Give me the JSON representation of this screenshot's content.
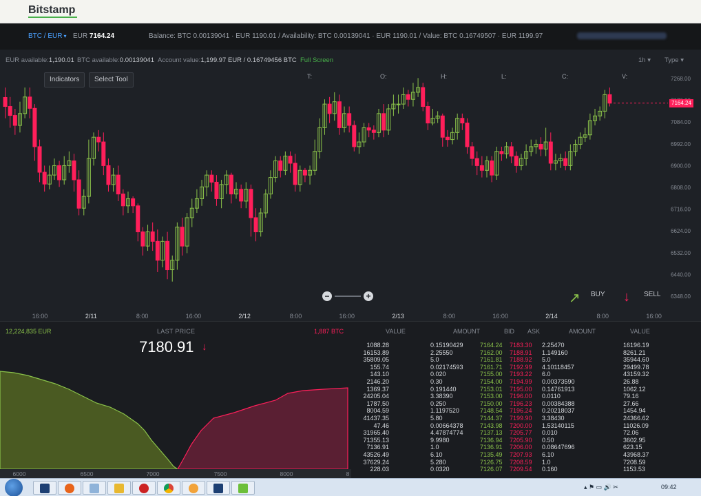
{
  "app": {
    "logo": "Bitstamp"
  },
  "account": {
    "pair": "BTC / EUR",
    "pair_caret": "▾",
    "eur_label": "EUR",
    "eur_price": "7164.24",
    "balance_line": "Balance: BTC 0.00139041 · EUR 1190.01 / Availability: BTC 0.00139041 · EUR 1190.01 / Value: BTC 0.16749507 · EUR 1199.97"
  },
  "info": {
    "eur_available_label": "EUR available:",
    "eur_available": "1,190.01",
    "btc_available_label": "BTC available:",
    "btc_available": "0.00139041",
    "account_value_label": "Account value:",
    "account_value": "1,199.97 EUR / 0.16749456 BTC",
    "fullscreen": "Full Screen",
    "timeframe": "1h",
    "type": "Type"
  },
  "chart_toolbar": {
    "indicators": "Indicators",
    "select_tool": "Select Tool",
    "ohlcv": [
      "T:",
      "O:",
      "H:",
      "L:",
      "C:",
      "V:"
    ]
  },
  "chart_data": {
    "type": "candlestick",
    "current_price": "7164.24",
    "y_ticks": [
      "7268.00",
      "7176.00",
      "7084.00",
      "6992.00",
      "6900.00",
      "6808.00",
      "6716.00",
      "6624.00",
      "6532.00",
      "6440.00",
      "6348.00"
    ],
    "x_ticks": [
      "16:00",
      "2/11",
      "8:00",
      "16:00",
      "2/12",
      "8:00",
      "16:00",
      "2/13",
      "8:00",
      "16:00",
      "2/14",
      "8:00",
      "16:00"
    ],
    "ylim": [
      6348,
      7268
    ],
    "candles": [
      [
        7188,
        7150,
        7100,
        7230
      ],
      [
        7150,
        7112,
        7060,
        7190
      ],
      [
        7112,
        7070,
        7030,
        7140
      ],
      [
        7070,
        7120,
        7040,
        7170
      ],
      [
        7120,
        7190,
        7100,
        7230
      ],
      [
        7190,
        7142,
        7100,
        7230
      ],
      [
        7142,
        6980,
        6920,
        7160
      ],
      [
        6980,
        6872,
        6830,
        7010
      ],
      [
        6872,
        6822,
        6790,
        6900
      ],
      [
        6822,
        6860,
        6800,
        6900
      ],
      [
        6860,
        6900,
        6840,
        6930
      ],
      [
        6900,
        6840,
        6810,
        6920
      ],
      [
        6840,
        6900,
        6820,
        6940
      ],
      [
        6900,
        6920,
        6870,
        6960
      ],
      [
        6920,
        6840,
        6790,
        6950
      ],
      [
        6840,
        6720,
        6690,
        6880
      ],
      [
        6720,
        6770,
        6690,
        6800
      ],
      [
        6770,
        6930,
        6740,
        7010
      ],
      [
        6930,
        7020,
        6900,
        7040
      ],
      [
        7020,
        7000,
        6960,
        7050
      ],
      [
        7000,
        6900,
        6860,
        7040
      ],
      [
        6900,
        6820,
        6790,
        6930
      ],
      [
        6820,
        6860,
        6790,
        6890
      ],
      [
        6860,
        6780,
        6750,
        6900
      ],
      [
        6780,
        6730,
        6690,
        6800
      ],
      [
        6730,
        6760,
        6700,
        6790
      ],
      [
        6760,
        6730,
        6700,
        6770
      ],
      [
        6730,
        6620,
        6580,
        6740
      ],
      [
        6620,
        6560,
        6520,
        6640
      ],
      [
        6560,
        6620,
        6540,
        6650
      ],
      [
        6620,
        6580,
        6540,
        6660
      ],
      [
        6580,
        6500,
        6450,
        6630
      ],
      [
        6500,
        6580,
        6470,
        6600
      ],
      [
        6580,
        6460,
        6420,
        6620
      ],
      [
        6460,
        6500,
        6410,
        6520
      ],
      [
        6500,
        6640,
        6460,
        6660
      ],
      [
        6640,
        6560,
        6520,
        6680
      ],
      [
        6560,
        6680,
        6530,
        6700
      ],
      [
        6680,
        6720,
        6640,
        6760
      ],
      [
        6720,
        6760,
        6700,
        6800
      ],
      [
        6760,
        6810,
        6730,
        6840
      ],
      [
        6810,
        6860,
        6770,
        6880
      ],
      [
        6860,
        6830,
        6790,
        6880
      ],
      [
        6830,
        6760,
        6730,
        6860
      ],
      [
        6760,
        6820,
        6720,
        6840
      ],
      [
        6820,
        6860,
        6780,
        6880
      ],
      [
        6860,
        6780,
        6740,
        6870
      ],
      [
        6780,
        6800,
        6760,
        6830
      ],
      [
        6800,
        6750,
        6720,
        6820
      ],
      [
        6750,
        6800,
        6720,
        6830
      ],
      [
        6800,
        6680,
        6600,
        6820
      ],
      [
        6680,
        6620,
        6580,
        6720
      ],
      [
        6620,
        6700,
        6600,
        6720
      ],
      [
        6700,
        6780,
        6680,
        6800
      ],
      [
        6780,
        6850,
        6760,
        6880
      ],
      [
        6850,
        6920,
        6830,
        6940
      ],
      [
        6920,
        6880,
        6850,
        6940
      ],
      [
        6880,
        6940,
        6860,
        6960
      ],
      [
        6940,
        6910,
        6870,
        6960
      ],
      [
        6910,
        6820,
        6790,
        6950
      ],
      [
        6820,
        6880,
        6790,
        6900
      ],
      [
        6880,
        6860,
        6830,
        6890
      ],
      [
        6860,
        6880,
        6820,
        6900
      ],
      [
        6880,
        6960,
        6860,
        7010
      ],
      [
        6960,
        7060,
        6930,
        7100
      ],
      [
        7060,
        7160,
        7030,
        7180
      ],
      [
        7160,
        7120,
        7080,
        7190
      ],
      [
        7120,
        7170,
        7090,
        7210
      ],
      [
        7170,
        7060,
        7030,
        7200
      ],
      [
        7060,
        7120,
        7040,
        7150
      ],
      [
        7120,
        7070,
        7040,
        7150
      ],
      [
        7070,
        6980,
        6960,
        7090
      ],
      [
        6980,
        7000,
        6950,
        7040
      ],
      [
        7000,
        7060,
        6980,
        7080
      ],
      [
        7060,
        7050,
        7020,
        7080
      ],
      [
        7050,
        7040,
        7010,
        7070
      ],
      [
        7040,
        7120,
        7020,
        7140
      ],
      [
        7120,
        7050,
        7020,
        7160
      ],
      [
        7050,
        7140,
        7030,
        7160
      ],
      [
        7140,
        7160,
        7110,
        7200
      ],
      [
        7160,
        7160,
        7120,
        7200
      ],
      [
        7160,
        7200,
        7140,
        7230
      ],
      [
        7200,
        7180,
        7150,
        7220
      ],
      [
        7180,
        7210,
        7150,
        7250
      ],
      [
        7210,
        7230,
        7190,
        7270
      ],
      [
        7230,
        7150,
        7130,
        7250
      ],
      [
        7150,
        7080,
        7050,
        7170
      ],
      [
        7080,
        7100,
        7070,
        7140
      ],
      [
        7100,
        7110,
        7080,
        7130
      ],
      [
        7110,
        7020,
        6980,
        7120
      ],
      [
        7020,
        7010,
        6980,
        7050
      ],
      [
        7010,
        7040,
        6990,
        7060
      ],
      [
        7040,
        7100,
        7010,
        7120
      ],
      [
        7100,
        7080,
        7050,
        7120
      ],
      [
        7080,
        6980,
        6950,
        7100
      ],
      [
        6980,
        6930,
        6900,
        7000
      ],
      [
        6930,
        6900,
        6860,
        6960
      ],
      [
        6900,
        6880,
        6850,
        6940
      ],
      [
        6880,
        6920,
        6850,
        6940
      ],
      [
        6920,
        6860,
        6830,
        6940
      ],
      [
        6860,
        6960,
        6840,
        6980
      ],
      [
        6960,
        6950,
        6920,
        6980
      ],
      [
        6950,
        6980,
        6930,
        7000
      ],
      [
        6980,
        6940,
        6910,
        7000
      ],
      [
        6940,
        6900,
        6870,
        6960
      ],
      [
        6900,
        6930,
        6880,
        6950
      ],
      [
        6930,
        6960,
        6900,
        6990
      ],
      [
        6960,
        6980,
        6940,
        7010
      ],
      [
        6980,
        6990,
        6950,
        7010
      ],
      [
        6990,
        6970,
        6940,
        7020
      ],
      [
        6970,
        7000,
        6940,
        7060
      ],
      [
        7000,
        6910,
        6880,
        7040
      ],
      [
        6910,
        6920,
        6880,
        6950
      ],
      [
        6920,
        6930,
        6890,
        6950
      ],
      [
        6930,
        6900,
        6880,
        6960
      ],
      [
        6900,
        6960,
        6880,
        6990
      ],
      [
        6960,
        6990,
        6940,
        7010
      ],
      [
        6990,
        7020,
        6970,
        7040
      ],
      [
        7020,
        7030,
        7000,
        7060
      ],
      [
        7030,
        7090,
        7010,
        7120
      ],
      [
        7090,
        7110,
        7070,
        7140
      ],
      [
        7110,
        7130,
        7090,
        7150
      ],
      [
        7130,
        7200,
        7100,
        7220
      ],
      [
        7200,
        7164,
        7150,
        7230
      ]
    ]
  },
  "trade": {
    "buy": "BUY",
    "sell": "SELL",
    "buy_arrow": "↗",
    "sell_arrow": "↓"
  },
  "depth_data": {
    "buy_total": "12,224,835 EUR",
    "sell_total": "1,887 BTC",
    "last_price_label": "LAST PRICE",
    "last_price": "7180.91",
    "last_price_arrow": "↓",
    "x_ticks": [
      "6000",
      "6500",
      "7000",
      "7500",
      "8000",
      "8"
    ],
    "buy_color": "#8bc34a",
    "sell_color": "#ff1f5a"
  },
  "order_book": {
    "headers": {
      "value": "VALUE",
      "amount": "AMOUNT",
      "bid": "BID",
      "ask": "ASK",
      "amount2": "AMOUNT",
      "value2": "VALUE"
    },
    "rows": [
      [
        "1088.28",
        "0.15190429",
        "7164.24",
        "7183.30",
        "2.25470",
        "16196.19"
      ],
      [
        "16153.89",
        "2.25550",
        "7162.00",
        "7188.91",
        "1.149160",
        "8261.21"
      ],
      [
        "35809.05",
        "5.0",
        "7161.81",
        "7188.92",
        "5.0",
        "35944.60"
      ],
      [
        "155.74",
        "0.02174593",
        "7161.71",
        "7192.99",
        "4.10118457",
        "29499.78"
      ],
      [
        "143.10",
        "0.020",
        "7155.00",
        "7193.22",
        "6.0",
        "43159.32"
      ],
      [
        "2146.20",
        "0.30",
        "7154.00",
        "7194.99",
        "0.00373590",
        "26.88"
      ],
      [
        "1369.37",
        "0.191440",
        "7153.01",
        "7195.00",
        "0.14761913",
        "1062.12"
      ],
      [
        "24205.04",
        "3.38390",
        "7153.00",
        "7196.00",
        "0.0110",
        "79.16"
      ],
      [
        "1787.50",
        "0.250",
        "7150.00",
        "7196.23",
        "0.00384388",
        "27.66"
      ],
      [
        "8004.59",
        "1.1197520",
        "7148.54",
        "7196.24",
        "0.20218037",
        "1454.94"
      ],
      [
        "41437.35",
        "5.80",
        "7144.37",
        "7199.90",
        "3.38430",
        "24366.62"
      ],
      [
        "47.46",
        "0.00664378",
        "7143.98",
        "7200.00",
        "1.53140115",
        "11026.09"
      ],
      [
        "31965.40",
        "4.47874774",
        "7137.13",
        "7205.77",
        "0.010",
        "72.06"
      ],
      [
        "71355.13",
        "9.9980",
        "7136.94",
        "7205.90",
        "0.50",
        "3602.95"
      ],
      [
        "7136.91",
        "1.0",
        "7136.91",
        "7206.00",
        "0.08647696",
        "623.15"
      ],
      [
        "43526.49",
        "6.10",
        "7135.49",
        "7207.93",
        "6.10",
        "43968.37"
      ],
      [
        "37629.24",
        "5.280",
        "7126.75",
        "7208.59",
        "1.0",
        "7208.59"
      ],
      [
        "228.03",
        "0.0320",
        "7126.07",
        "7209.54",
        "0.160",
        "1153.53"
      ]
    ]
  },
  "taskbar": {
    "clock": "09:42"
  }
}
